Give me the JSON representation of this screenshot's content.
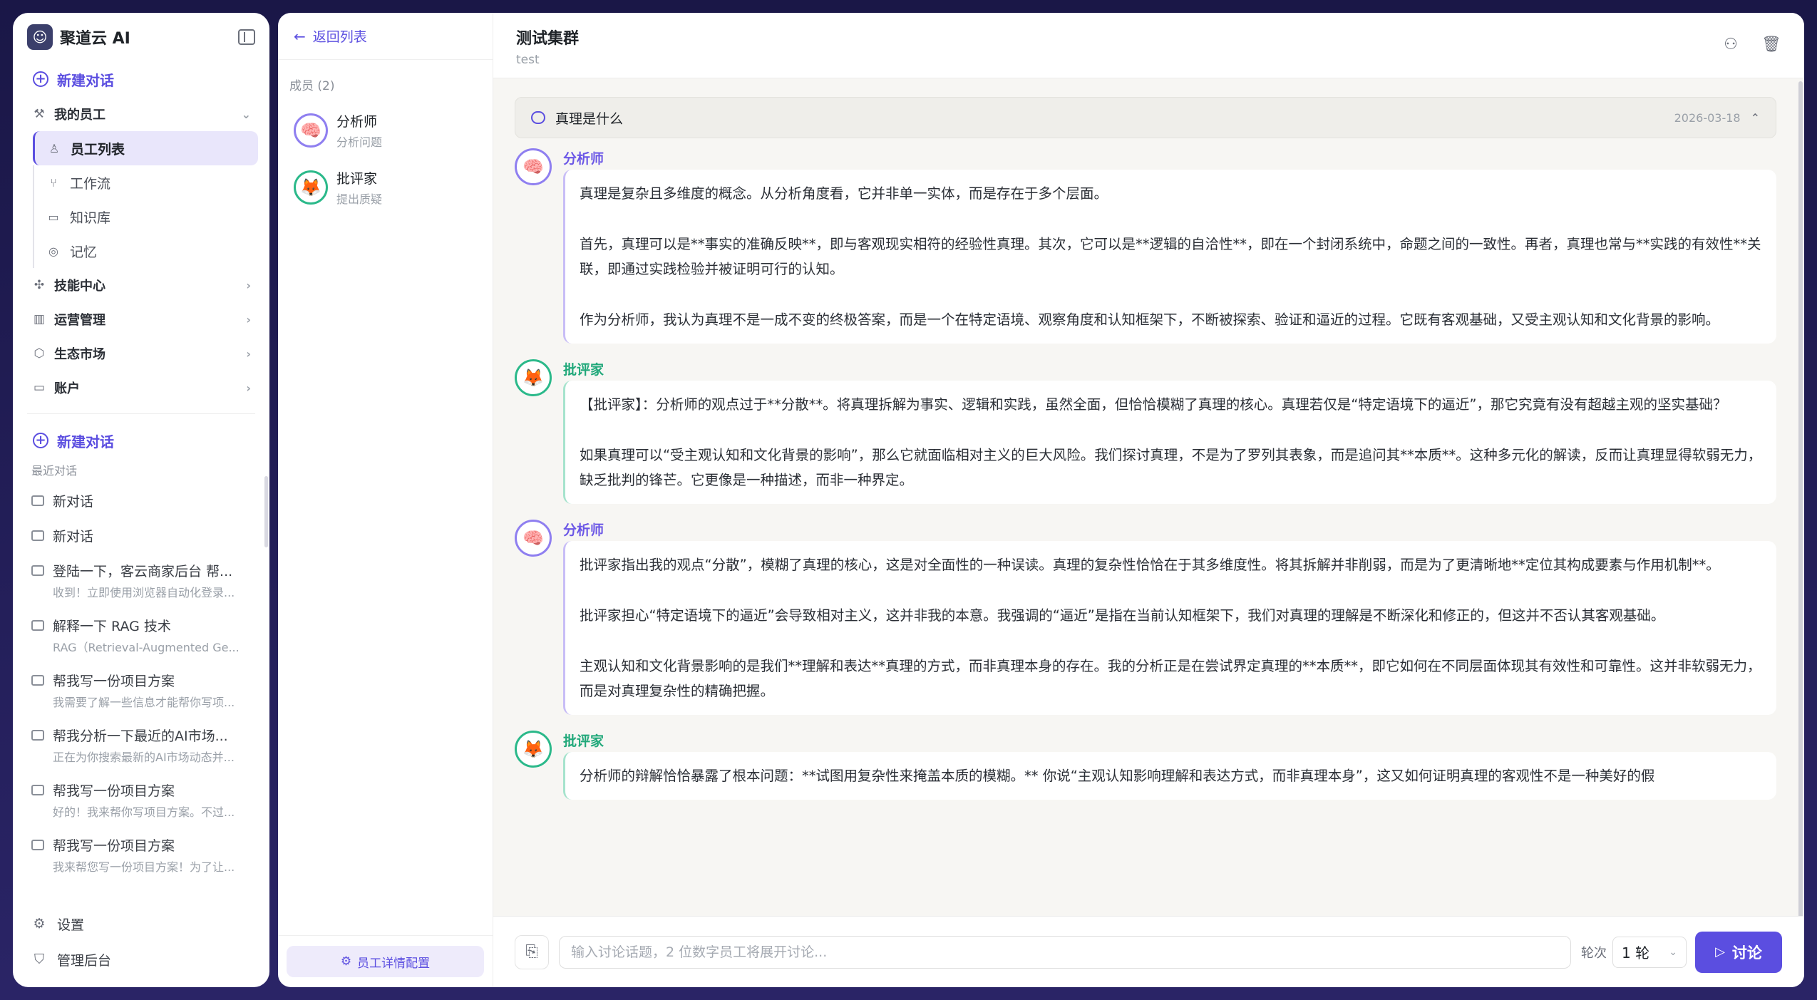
{
  "app": {
    "brand_name": "聚道云 AI"
  },
  "sidebar": {
    "new_chat_label": "新建对话",
    "my_staff_label": "我的员工",
    "staff_sub_items": [
      {
        "label": "员工列表"
      },
      {
        "label": "工作流"
      },
      {
        "label": "知识库"
      },
      {
        "label": "记忆"
      }
    ],
    "groups": [
      {
        "label": "技能中心"
      },
      {
        "label": "运营管理"
      },
      {
        "label": "生态市场"
      },
      {
        "label": "账户"
      }
    ],
    "new_chat_label_2": "新建对话",
    "recent_label": "最近对话",
    "recent": [
      {
        "title": "新对话",
        "preview": ""
      },
      {
        "title": "新对话",
        "preview": ""
      },
      {
        "title": "登陆一下，客云商家后台 帮...",
        "preview": "收到！立即使用浏览器自动化登录..."
      },
      {
        "title": "解释一下 RAG 技术",
        "preview": "RAG（Retrieval-Augmented Ge..."
      },
      {
        "title": "帮我写一份项目方案",
        "preview": "我需要了解一些信息才能帮你写项..."
      },
      {
        "title": "帮我分析一下最近的AI市场...",
        "preview": "正在为你搜索最新的AI市场动态并..."
      },
      {
        "title": "帮我写一份项目方案",
        "preview": "好的！我来帮你写项目方案。不过..."
      },
      {
        "title": "帮我写一份项目方案",
        "preview": "我来帮您写一份项目方案！为了让..."
      }
    ],
    "settings_label": "设置",
    "admin_label": "管理后台"
  },
  "members_panel": {
    "back_label": "返回列表",
    "heading": "成员 (2)",
    "members": [
      {
        "name": "分析师",
        "role": "分析问题"
      },
      {
        "name": "批评家",
        "role": "提出质疑"
      }
    ],
    "config_label": "员工详情配置"
  },
  "chat": {
    "title": "测试集群",
    "subtitle": "test",
    "topic": "真理是什么",
    "topic_date": "2026-03-18",
    "messages": [
      {
        "speaker": "分析师",
        "paragraphs": [
          "真理是复杂且多维度的概念。从分析角度看，它并非单一实体，而是存在于多个层面。",
          "首先，真理可以是**事实的准确反映**，即与客观现实相符的经验性真理。其次，它可以是**逻辑的自洽性**，即在一个封闭系统中，命题之间的一致性。再者，真理也常与**实践的有效性**关联，即通过实践检验并被证明可行的认知。",
          "作为分析师，我认为真理不是一成不变的终极答案，而是一个在特定语境、观察角度和认知框架下，不断被探索、验证和逼近的过程。它既有客观基础，又受主观认知和文化背景的影响。"
        ]
      },
      {
        "speaker": "批评家",
        "paragraphs": [
          "【批评家】：分析师的观点过于**分散**。将真理拆解为事实、逻辑和实践，虽然全面，但恰恰模糊了真理的核心。真理若仅是“特定语境下的逼近”，那它究竟有没有超越主观的坚实基础？",
          "如果真理可以“受主观认知和文化背景的影响”，那么它就面临相对主义的巨大风险。我们探讨真理，不是为了罗列其表象，而是追问其**本质**。这种多元化的解读，反而让真理显得软弱无力，缺乏批判的锋芒。它更像是一种描述，而非一种界定。"
        ]
      },
      {
        "speaker": "分析师",
        "paragraphs": [
          "批评家指出我的观点“分散”，模糊了真理的核心，这是对全面性的一种误读。真理的复杂性恰恰在于其多维度性。将其拆解并非削弱，而是为了更清晰地**定位其构成要素与作用机制**。",
          "批评家担心“特定语境下的逼近”会导致相对主义，这并非我的本意。我强调的“逼近”是指在当前认知框架下，我们对真理的理解是不断深化和修正的，但这并不否认其客观基础。",
          "主观认知和文化背景影响的是我们**理解和表达**真理的方式，而非真理本身的存在。我的分析正是在尝试界定真理的**本质**，即它如何在不同层面体现其有效性和可靠性。这并非软弱无力，而是对真理复杂性的精确把握。"
        ]
      },
      {
        "speaker": "批评家",
        "paragraphs": [
          "分析师的辩解恰恰暴露了根本问题：**试图用复杂性来掩盖本质的模糊。** 你说“主观认知影响理解和表达方式，而非真理本身”，这又如何证明真理的客观性不是一种美好的假"
        ]
      }
    ],
    "input_placeholder": "输入讨论话题，2 位数字员工将展开讨论...",
    "rounds_label": "轮次",
    "rounds_value": "1 轮",
    "send_label": "讨论"
  },
  "colors": {
    "accent": "#5b4ee0",
    "analyst": "#6b57e6",
    "critic": "#21a87a"
  }
}
